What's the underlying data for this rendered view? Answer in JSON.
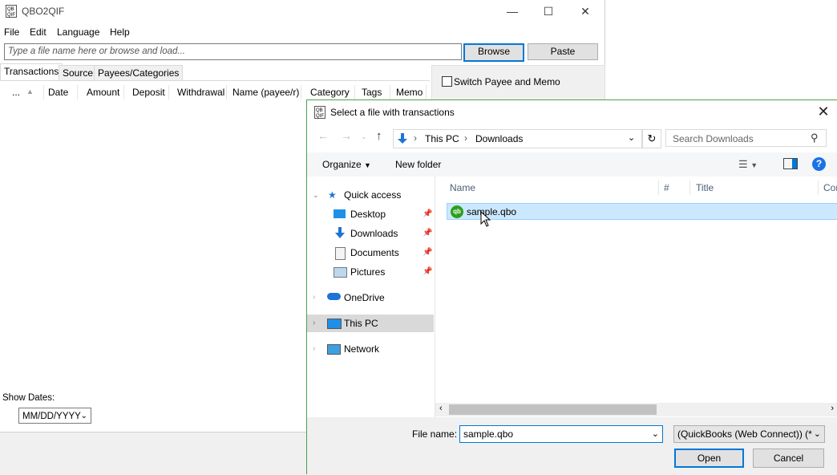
{
  "app": {
    "title": "QBO2QIF",
    "menu": [
      "File",
      "Edit",
      "Language",
      "Help"
    ],
    "file_input_placeholder": "Type a file name here or browse and load...",
    "browse_label": "Browse",
    "paste_label": "Paste",
    "tabs": [
      "Transactions",
      "Source",
      "Payees/Categories"
    ],
    "columns": [
      "...",
      "Date",
      "Amount",
      "Deposit",
      "Withdrawal",
      "Name (payee/r)",
      "Category",
      "Tags",
      "Memo"
    ],
    "switch_label": "Switch Payee and Memo",
    "show_dates_label": "Show Dates:",
    "date_format": "MM/DD/YYYY"
  },
  "dialog": {
    "title": "Select a file with transactions",
    "breadcrumb": [
      "This PC",
      "Downloads"
    ],
    "search_placeholder": "Search Downloads",
    "organize_label": "Organize",
    "new_folder_label": "New folder",
    "nav": {
      "quick_access": "Quick access",
      "quick_items": [
        "Desktop",
        "Downloads",
        "Documents",
        "Pictures"
      ],
      "onedrive": "OneDrive",
      "this_pc": "This PC",
      "network": "Network"
    },
    "columns": [
      "Name",
      "#",
      "Title",
      "Con"
    ],
    "files": [
      {
        "name": "sample.qbo"
      }
    ],
    "file_name_label": "File name:",
    "file_name_value": "sample.qbo",
    "file_type_value": "(QuickBooks (Web Connect)) (*",
    "open_label": "Open",
    "cancel_label": "Cancel"
  },
  "colors": {
    "accent": "#0078d7",
    "selection": "#cce8ff",
    "dialog_border": "#49a24d",
    "qb_green": "#2ca01c"
  }
}
